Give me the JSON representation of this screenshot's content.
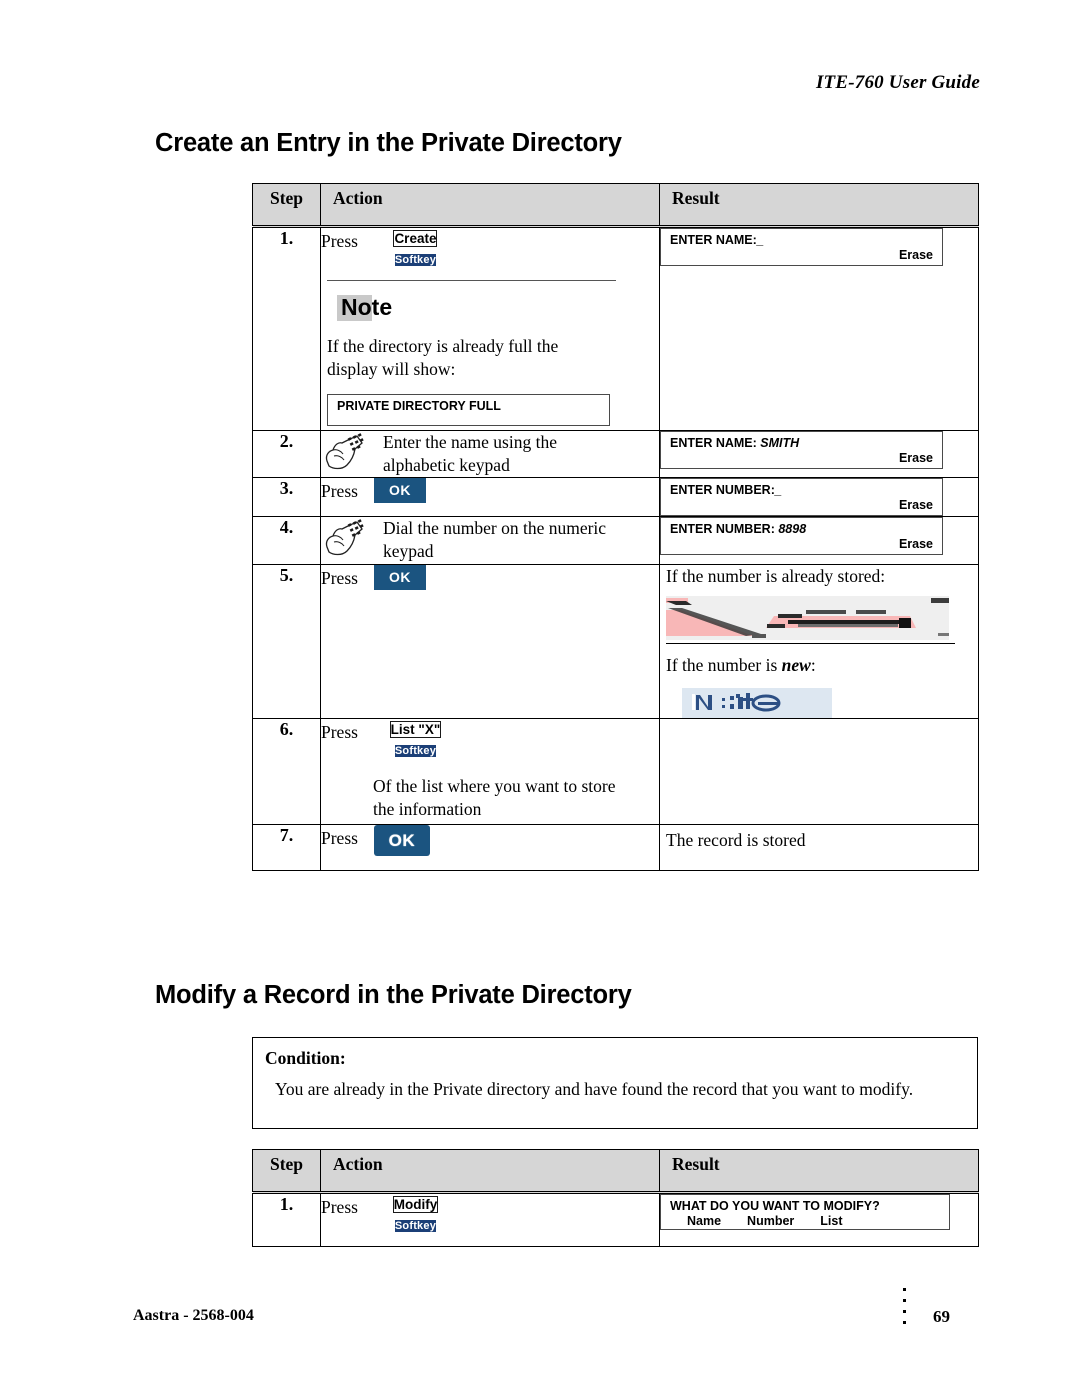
{
  "running_head": "ITE-760 User Guide",
  "sections": {
    "create": {
      "heading": "Create an Entry in the Private Directory",
      "table": {
        "headers": {
          "step": "Step",
          "action": "Action",
          "result": "Result"
        },
        "rows": [
          {
            "step": "1.",
            "press_label": "Press",
            "softkey": {
              "cap": "Create",
              "band": "Softkey"
            },
            "note": {
              "label": "Note",
              "text": "If the directory is already full the display will show:",
              "display": "PRIVATE DIRECTORY FULL"
            },
            "result_display": {
              "label": "ENTER NAME:",
              "value": "_",
              "soft_right": "Erase"
            }
          },
          {
            "step": "2.",
            "icon": "hand-keypad-icon",
            "text": "Enter the name using the alphabetic keypad",
            "result_display": {
              "label": "ENTER NAME:",
              "value": "SMITH",
              "soft_right": "Erase"
            }
          },
          {
            "step": "3.",
            "press_label": "Press",
            "okkey": "OK",
            "result_display": {
              "label": "ENTER NUMBER:",
              "value": "_",
              "soft_right": "Erase"
            }
          },
          {
            "step": "4.",
            "icon": "hand-keypad-icon",
            "text": "Dial the number on the numeric keypad",
            "result_display": {
              "label": "ENTER NUMBER:",
              "value": "8898",
              "soft_right": "Erase"
            }
          },
          {
            "step": "5.",
            "press_label": "Press",
            "okkey": "OK",
            "result_stored_label": "If the number is already stored:",
            "result_new_label_a": "If the number is ",
            "result_new_label_b": "new",
            "result_new_label_c": ":",
            "result_glitch_note": "Note"
          },
          {
            "step": "6.",
            "press_label": "Press",
            "softkey": {
              "cap": "List \"X\"",
              "band": "Softkey"
            },
            "text": "Of the list where you want to store the information"
          },
          {
            "step": "7.",
            "press_label": "Press",
            "okkey_lg": "OK",
            "result_text": "The record is stored"
          }
        ]
      }
    },
    "modify": {
      "heading": "Modify a Record in the Private Directory",
      "condition": {
        "title": "Condition:",
        "text": "You are already in the Private directory and have found the record that you want to modify."
      },
      "table": {
        "headers": {
          "step": "Step",
          "action": "Action",
          "result": "Result"
        },
        "rows": [
          {
            "step": "1.",
            "press_label": "Press",
            "softkey": {
              "cap": "Modify",
              "band": "Softkey"
            },
            "result_display": {
              "line1": "WHAT DO YOU WANT TO MODIFY?",
              "opt1": "Name",
              "opt2": "Number",
              "opt3": "List"
            }
          }
        ]
      }
    }
  },
  "footer": {
    "doc_id": "Aastra - 2568-004",
    "page_number": "69"
  },
  "colors": {
    "softkey_band": "#1b3f77",
    "ok_key": "#1b5480",
    "table_header_bg": "#d6d6d6",
    "note_highlight": "#c9c9c9",
    "glitch_pink": "#f8b7b7"
  }
}
